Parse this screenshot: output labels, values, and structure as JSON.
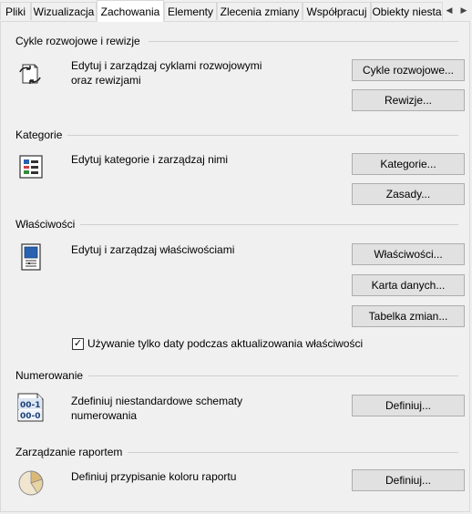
{
  "tabs": [
    {
      "label": "Pliki",
      "active": false
    },
    {
      "label": "Wizualizacja",
      "active": false
    },
    {
      "label": "Zachowania",
      "active": true
    },
    {
      "label": "Elementy",
      "active": false
    },
    {
      "label": "Zlecenia zmiany",
      "active": false
    },
    {
      "label": "Współpracuj",
      "active": false
    },
    {
      "label": "Obiekty niesta",
      "active": false
    }
  ],
  "tab_scroll": {
    "left_icon": "chevron-left-icon",
    "right_icon": "chevron-right-icon"
  },
  "sections": {
    "cycles": {
      "title": "Cykle rozwojowe i rewizje",
      "icon": "lifecycle-arrows-icon",
      "description": "Edytuj i zarządzaj cyklami rozwojowymi oraz rewizjami",
      "buttons": [
        "Cykle rozwojowe...",
        "Rewizje..."
      ]
    },
    "categories": {
      "title": "Kategorie",
      "icon": "categories-list-icon",
      "description": "Edytuj kategorie i zarządzaj nimi",
      "buttons": [
        "Kategorie...",
        "Zasady..."
      ]
    },
    "properties": {
      "title": "Właściwości",
      "icon": "properties-sheet-icon",
      "description": "Edytuj i zarządzaj właściwościami",
      "buttons": [
        "Właściwości...",
        "Karta danych...",
        "Tabelka zmian..."
      ],
      "checkbox_label": "Używanie tylko daty podczas aktualizowania właściwości",
      "checkbox_checked": true
    },
    "numbering": {
      "title": "Numerowanie",
      "icon": "numbering-scheme-icon",
      "icon_text_top": "00-1",
      "icon_text_bottom": "00-0",
      "description": "Zdefiniuj niestandardowe schematy numerowania",
      "buttons": [
        "Definiuj..."
      ]
    },
    "reports": {
      "title": "Zarządzanie raportem",
      "icon": "pie-chart-icon",
      "description": "Definiuj przypisanie koloru raportu",
      "buttons": [
        "Definiuj..."
      ]
    }
  },
  "colors": {
    "accent": "#1f5fa8",
    "background": "#f0f0f0",
    "button": "#e1e1e1"
  }
}
